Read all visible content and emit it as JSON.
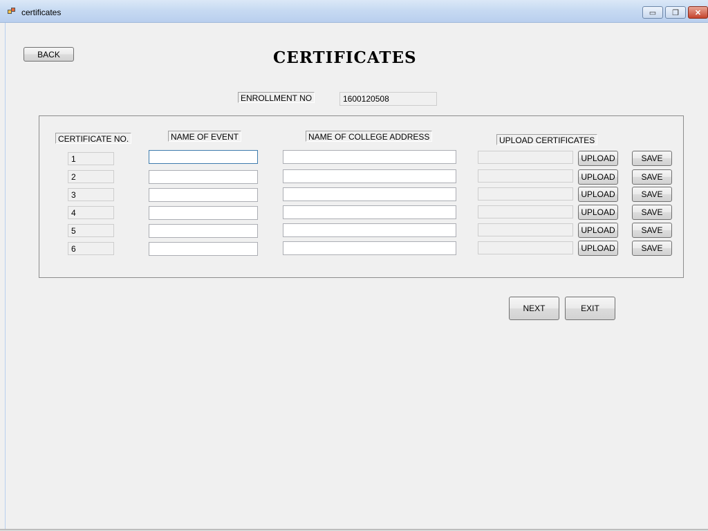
{
  "window": {
    "title": "certificates",
    "min_glyph": "▭",
    "max_glyph": "❐",
    "close_glyph": "✕"
  },
  "header": {
    "back_label": "BACK",
    "heading": "CERTIFICATES"
  },
  "enrollment": {
    "label": "ENROLLMENT NO",
    "value": "1600120508"
  },
  "table": {
    "col_cert_no": "CERTIFICATE NO.",
    "col_event": "NAME OF EVENT",
    "col_college": "NAME OF COLLEGE  ADDRESS",
    "col_upload": "UPLOAD CERTIFICATES",
    "rows": [
      {
        "no": "1",
        "event": "",
        "college": "",
        "file": "",
        "upload_label": "UPLOAD",
        "save_label": "SAVE"
      },
      {
        "no": "2",
        "event": "",
        "college": "",
        "file": "",
        "upload_label": "UPLOAD",
        "save_label": "SAVE"
      },
      {
        "no": "3",
        "event": "",
        "college": "",
        "file": "",
        "upload_label": "UPLOAD",
        "save_label": "SAVE"
      },
      {
        "no": "4",
        "event": "",
        "college": "",
        "file": "",
        "upload_label": "UPLOAD",
        "save_label": "SAVE"
      },
      {
        "no": "5",
        "event": "",
        "college": "",
        "file": "",
        "upload_label": "UPLOAD",
        "save_label": "SAVE"
      },
      {
        "no": "6",
        "event": "",
        "college": "",
        "file": "",
        "upload_label": "UPLOAD",
        "save_label": "SAVE"
      }
    ]
  },
  "footer": {
    "next_label": "NEXT",
    "exit_label": "EXIT"
  }
}
